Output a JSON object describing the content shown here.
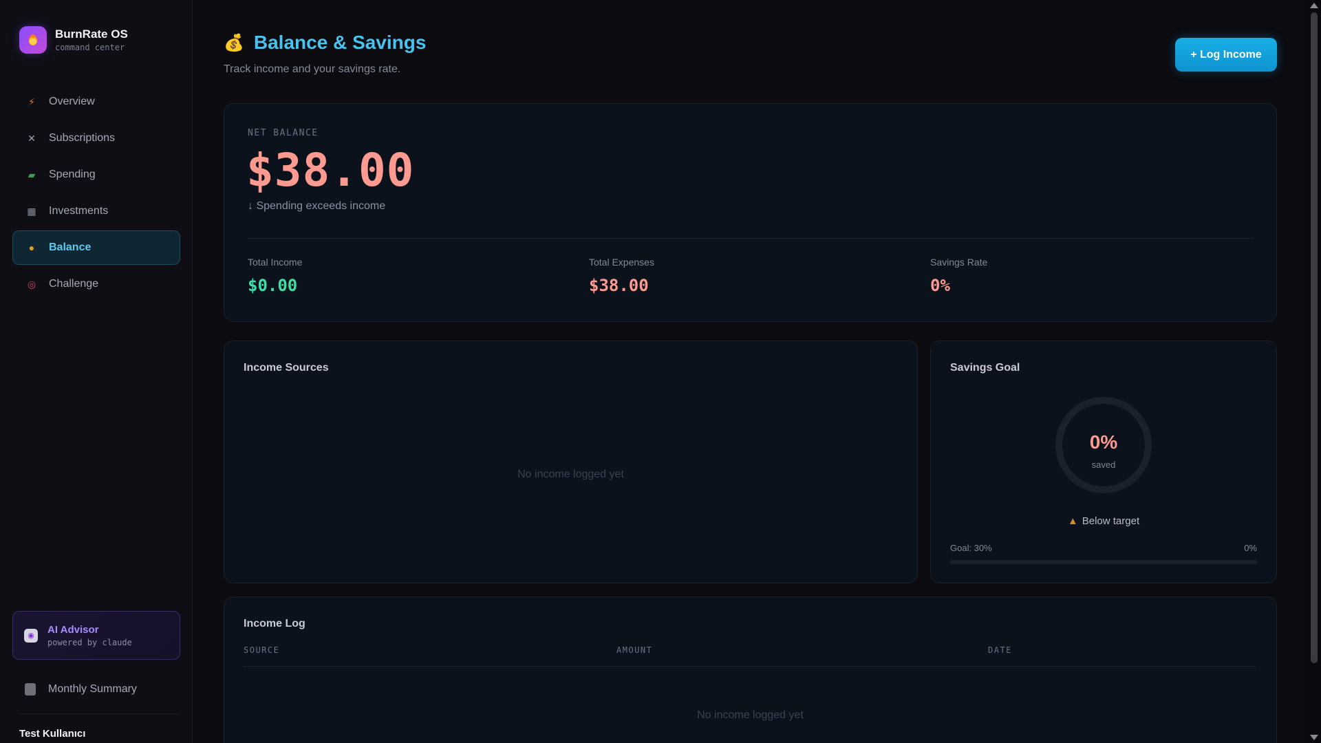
{
  "brand": {
    "title": "BurnRate OS",
    "subtitle": "command center"
  },
  "sidebar": {
    "items": [
      {
        "label": "Overview",
        "icon": "lightning-icon"
      },
      {
        "label": "Subscriptions",
        "icon": "crossed-swords-icon"
      },
      {
        "label": "Spending",
        "icon": "money-wings-icon"
      },
      {
        "label": "Investments",
        "icon": "chart-icon"
      },
      {
        "label": "Balance",
        "icon": "money-bag-icon",
        "active": true
      },
      {
        "label": "Challenge",
        "icon": "target-icon"
      }
    ],
    "advisor": {
      "title": "AI Advisor",
      "subtitle": "powered by claude"
    },
    "summary": "Monthly Summary",
    "user": "Test Kullanıcı"
  },
  "page": {
    "title": "Balance & Savings",
    "subtitle": "Track income and your savings rate.",
    "log_button": "+ Log Income"
  },
  "net": {
    "label": "NET BALANCE",
    "value": "$38.00",
    "status": "↓ Spending exceeds income",
    "stats": [
      {
        "label": "Total Income",
        "value": "$0.00"
      },
      {
        "label": "Total Expenses",
        "value": "$38.00"
      },
      {
        "label": "Savings Rate",
        "value": "0%"
      }
    ]
  },
  "sources": {
    "title": "Income Sources",
    "empty": "No income logged yet"
  },
  "goal": {
    "title": "Savings Goal",
    "ring_pct": "0%",
    "ring_sub": "saved",
    "status": "Below target",
    "goal_label": "Goal: 30%",
    "current_label": "0%",
    "progress": 0
  },
  "log": {
    "title": "Income Log",
    "columns": [
      "SOURCE",
      "AMOUNT",
      "DATE"
    ],
    "empty": "No income logged yet"
  },
  "colors": {
    "accent": "#48c3f0",
    "negative": "#ff9a90",
    "positive": "#3ce0a6"
  }
}
